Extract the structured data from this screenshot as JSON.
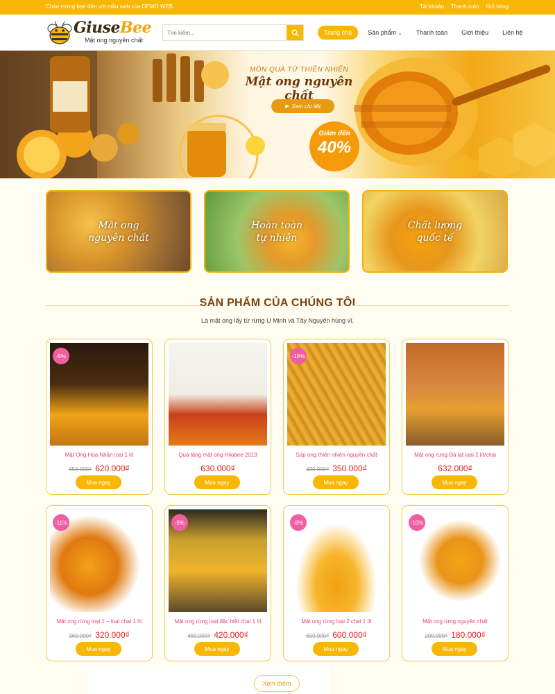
{
  "topbar": {
    "welcome": "Chào mừng bạn đến với mẫu web của DEMO WEB",
    "links": [
      "Tài khoản",
      "Thanh toán",
      "Giỏ hàng"
    ]
  },
  "header": {
    "logo_word_a": "Giuse",
    "logo_word_b": "Bee",
    "logo_tagline": "Mật ong nguyên chất",
    "search_placeholder": "Tìm kiếm...",
    "nav": [
      "Trang chủ",
      "Sản phẩm",
      "Thanh toán",
      "Giới thiệu",
      "Liên hệ"
    ]
  },
  "hero": {
    "subtitle": "MÓN QUÀ TỪ THIÊN NHIÊN",
    "title": "Mật ong nguyên chất",
    "button": "Xem chi tiết",
    "discount_line1": "Giảm đến",
    "discount_line2": "40%"
  },
  "categories": [
    "Mật ong nguyên chất",
    "Hoàn toàn tự nhiên",
    "Chất lượng quốc tế"
  ],
  "section": {
    "title": "SẢN PHẨM CỦA CHÚNG TÔI",
    "subtitle": "Là mật ong lấy từ rừng U Minh và Tây Nguyên hùng vĩ."
  },
  "buy_label": "Mua ngay",
  "more_label": "Xem thêm",
  "products": [
    {
      "name": "Mật Ong Hoa Nhãn loại 1 lít",
      "badge": "-5%",
      "old": "650.000₫",
      "price": "620.000₫"
    },
    {
      "name": "Quà tặng mật ong Hilobee 2019",
      "badge": "",
      "old": "",
      "price": "630.000₫"
    },
    {
      "name": "Sáp ong thiên nhiên nguyên chất",
      "badge": "-19%",
      "old": "430.000₫",
      "price": "350.000₫"
    },
    {
      "name": "Mật ong rừng Đà lạt loại 2 lít/chai",
      "badge": "",
      "old": "",
      "price": "632.000₫"
    },
    {
      "name": "Mật ong rừng loại 1 – loại chai 1 lít",
      "badge": "-11%",
      "old": "360.000₫",
      "price": "320.000₫"
    },
    {
      "name": "Mật ong rừng loại đặc biệt chai 1 lít",
      "badge": "-9%",
      "old": "460.000₫",
      "price": "420.000₫"
    },
    {
      "name": "Mật ong rừng loại 2 chai 1 lít",
      "badge": "-8%",
      "old": "650.000₫",
      "price": "600.000₫"
    },
    {
      "name": "Mật ong rừng nguyên chất",
      "badge": "-10%",
      "old": "200.000₫",
      "price": "180.000₫"
    }
  ],
  "colors": {
    "accent": "#f8b705",
    "pink": "#f05da0",
    "price": "#e0201c",
    "title": "#7a4010"
  }
}
